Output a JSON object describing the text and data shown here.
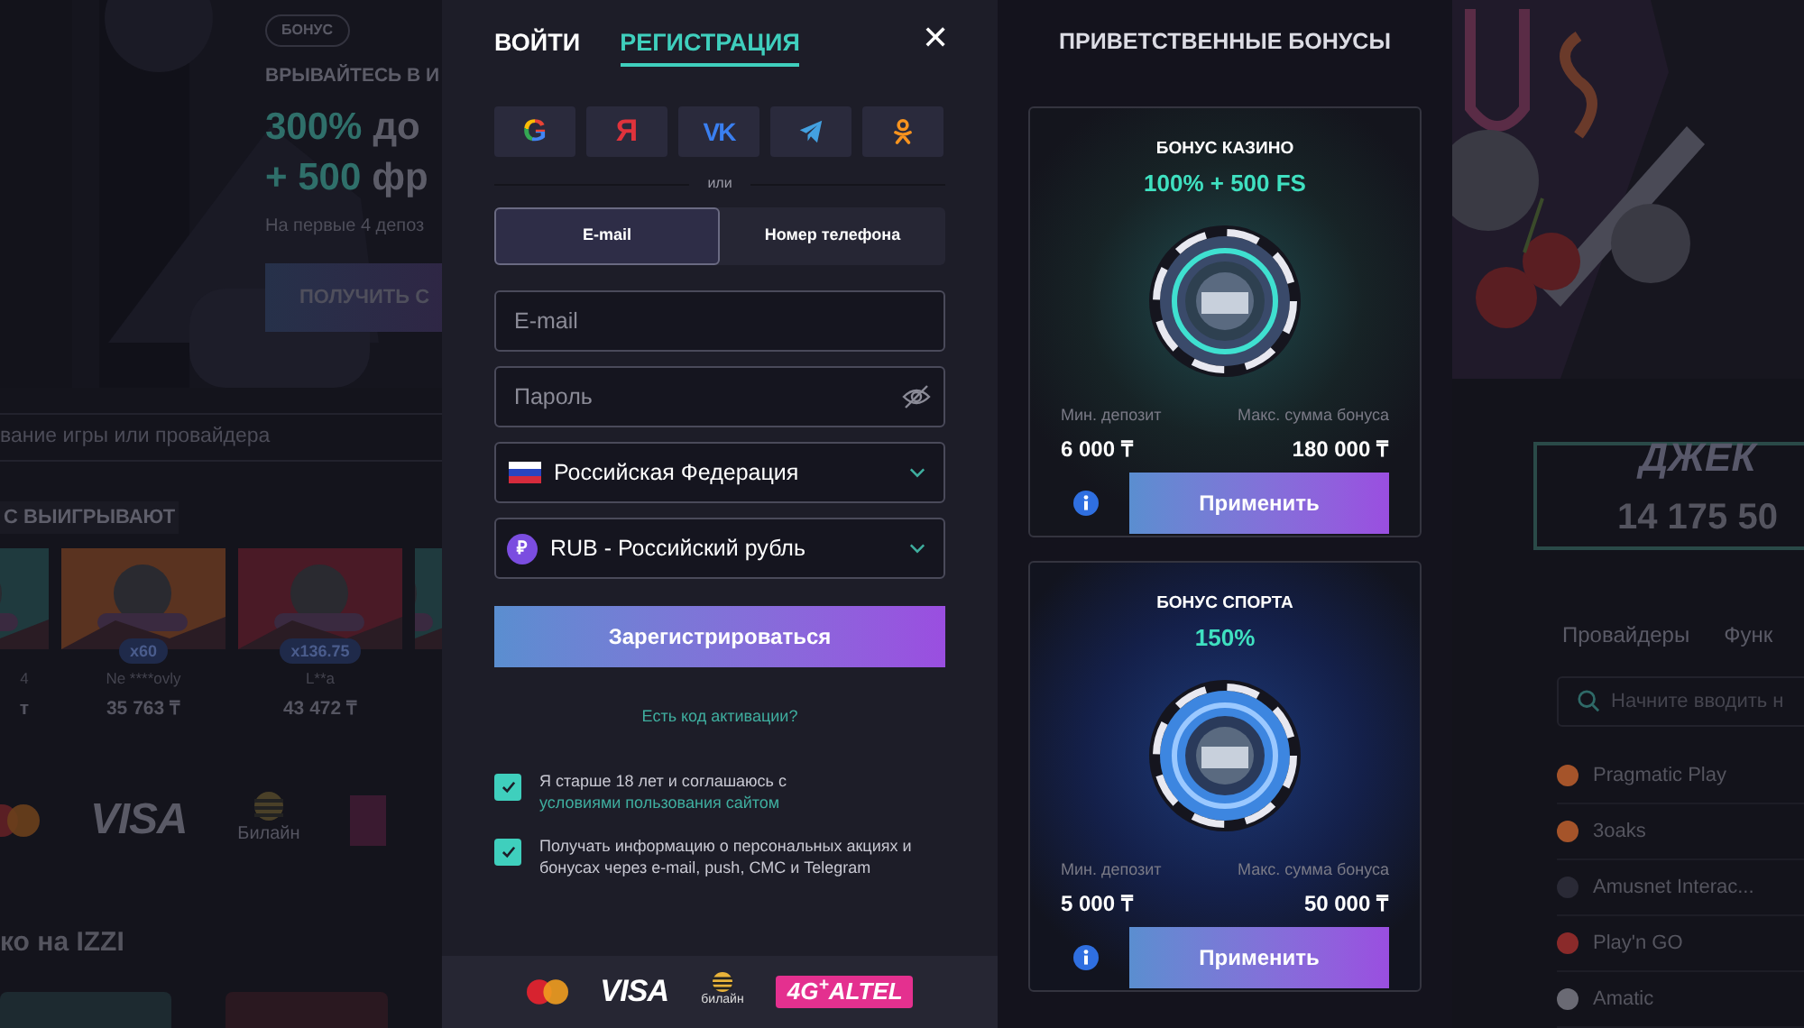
{
  "background_left": {
    "badge": "БОНУС",
    "headline": "ВРЫВАЙТЕСЬ В И",
    "amount_lines": [
      {
        "accent": "300%",
        "rest": "до"
      },
      {
        "accent": "+ 500",
        "rest": "фр"
      }
    ],
    "subtitle": "На первые 4 депоз",
    "button": "ПОЛУЧИТЬ С",
    "search": {
      "placeholder": "вание игры или провайдера"
    },
    "winners_title": "С ВЫИГРЫВАЮТ",
    "winners": [
      {
        "kind": "partial",
        "name": "4",
        "amount": "т"
      },
      {
        "kind": "tile",
        "multiplier": "x60",
        "name": "Ne ****ovly",
        "amount": "35 763 ₸"
      },
      {
        "kind": "tile",
        "multiplier": "x136.75",
        "name": "L**a",
        "amount": "43 472 ₸"
      },
      {
        "kind": "edge"
      }
    ],
    "payments": [
      {
        "kind": "mastercard"
      },
      {
        "kind": "visa",
        "text": "VISA"
      },
      {
        "kind": "beeline",
        "text": "Билайн"
      },
      {
        "kind": "edge"
      }
    ],
    "section_title": "ко на IZZI"
  },
  "modal": {
    "auth_tabs": [
      {
        "label": "ВОЙТИ",
        "selected": false
      },
      {
        "label": "РЕГИСТРАЦИЯ",
        "selected": true
      }
    ],
    "close": "✕",
    "social_logins": [
      {
        "kind": "google",
        "glyph": "G"
      },
      {
        "kind": "yandex",
        "glyph": "Я"
      },
      {
        "kind": "vk",
        "glyph": "VK"
      },
      {
        "kind": "telegram"
      },
      {
        "kind": "ok"
      }
    ],
    "divider_text": "или",
    "method_tabs": [
      {
        "label": "E-mail",
        "selected": true
      },
      {
        "label": "Номер телефона",
        "selected": false
      }
    ],
    "fields": [
      {
        "kind": "text",
        "placeholder": "E-mail"
      },
      {
        "kind": "password",
        "placeholder": "Пароль"
      },
      {
        "kind": "country",
        "value": "Российская Федерация"
      },
      {
        "kind": "currency",
        "symbol": "₽",
        "value": "RUB - Российский рубль"
      }
    ],
    "submit": "Зарегистрироваться",
    "promo_link": "Есть код активации?",
    "consents": [
      {
        "checked": true,
        "text": "Я старше 18 лет и соглашаюсь с",
        "link": "условиями пользования сайтом"
      },
      {
        "checked": true,
        "text": "Получать информацию о персональных акциях и бонусах через e-mail, push, СМС и Telegram"
      }
    ],
    "footer_payments": [
      {
        "kind": "mastercard"
      },
      {
        "kind": "visa",
        "text": "VISA"
      },
      {
        "kind": "beeline",
        "text": "билайн"
      },
      {
        "kind": "altel",
        "text": "4G$^{+}$ALTEL"
      }
    ]
  },
  "bonuses": {
    "title": "ПРИВЕТСТВЕННЫЕ БОНУСЫ",
    "cards": [
      {
        "kind": "casino",
        "label": "БОНУС КАЗИНО",
        "value": "100% + 500 FS",
        "min_label": "Мин. депозит",
        "min": "6 000 ₸",
        "max_label": "Макс. сумма бонуса",
        "max": "180 000 ₸",
        "button": "Применить"
      },
      {
        "kind": "sport",
        "label": "БОНУС СПОРТА",
        "value": "150%",
        "min_label": "Мин. депозит",
        "min": "5 000 ₸",
        "max_label": "Макс. сумма бонуса",
        "max": "50 000 ₸",
        "button": "Применить"
      }
    ]
  },
  "background_right": {
    "jackpot_title": "ДЖЕК",
    "jackpot_amount": "14 175 50",
    "tabs": [
      "Провайдеры",
      "Функ"
    ],
    "search": {
      "placeholder": "Начните вводить н"
    },
    "providers": [
      {
        "name": "Pragmatic Play",
        "color": "#a5542a"
      },
      {
        "name": "3oaks",
        "color": "#a5542a"
      },
      {
        "name": "Amusnet Interac...",
        "color": "#2a2a36"
      },
      {
        "name": "Play'n GO",
        "color": "#8a2a2a"
      },
      {
        "name": "Amatic",
        "color": "#6a6a74"
      }
    ]
  }
}
